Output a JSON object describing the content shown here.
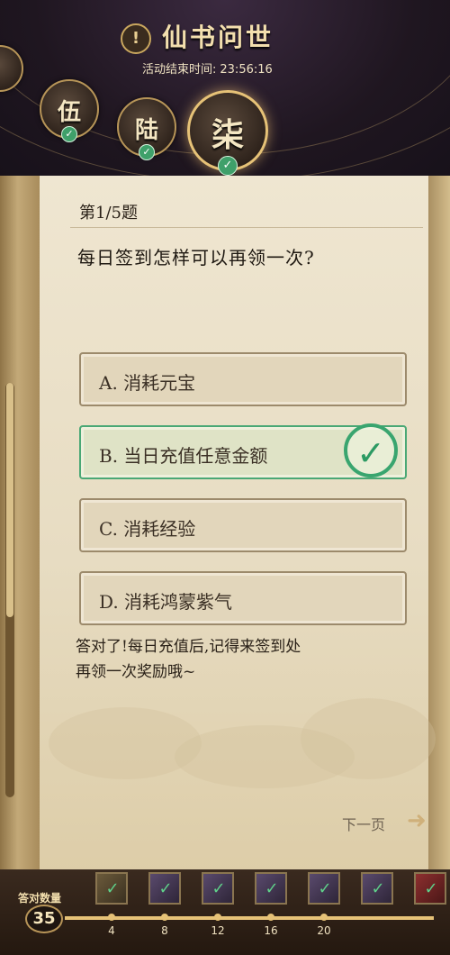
{
  "header": {
    "title": "仙书问世",
    "icon": "exclamation-icon",
    "countdown_label": "活动结束时间:",
    "countdown_value": "23:56:16",
    "chapters": [
      {
        "label": "伍",
        "completed": true
      },
      {
        "label": "陆",
        "completed": true
      },
      {
        "label": "柒",
        "completed": true,
        "active": true
      }
    ]
  },
  "quiz": {
    "question_number": "第1/5题",
    "question": "每日签到怎样可以再领一次?",
    "options": [
      {
        "label": "A. 消耗元宝",
        "correct": false
      },
      {
        "label": "B. 当日充值任意金额",
        "correct": true
      },
      {
        "label": "C. 消耗经验",
        "correct": false
      },
      {
        "label": "D. 消耗鸿蒙紫气",
        "correct": false
      }
    ],
    "feedback_line1": "答对了!每日充值后,记得来签到处",
    "feedback_line2": "再领一次奖励哦~",
    "next_label": "下一页"
  },
  "progress": {
    "label": "答对数量",
    "count": "35",
    "milestones": [
      "4",
      "8",
      "12",
      "16",
      "20"
    ],
    "colors": {
      "accent": "#e6c277",
      "correct": "#39a56f"
    }
  }
}
